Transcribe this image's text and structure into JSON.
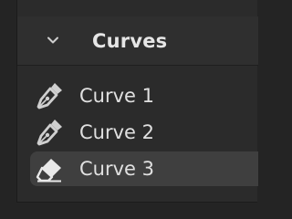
{
  "panel": {
    "title": "Curves"
  },
  "curves": [
    {
      "label": "Curve 1",
      "icon": "pen-icon",
      "selected": false
    },
    {
      "label": "Curve 2",
      "icon": "pen-icon",
      "selected": false
    },
    {
      "label": "Curve 3",
      "icon": "eraser-icon",
      "selected": true
    }
  ],
  "colors": {
    "background": "#242424",
    "panel": "#2b2b2b",
    "header": "#2f2f2f",
    "selected_row": "#3f3f3f",
    "text": "#e0e0e0"
  }
}
